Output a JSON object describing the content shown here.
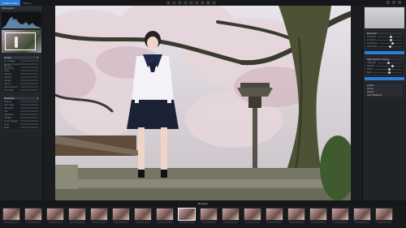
{
  "app": {
    "title": "Capture One",
    "tabs": [
      "Capture One",
      "Library"
    ]
  },
  "toolbar": {
    "icons": [
      "cursor-icon",
      "crop-icon",
      "straighten-icon",
      "keystone-icon",
      "spot-icon",
      "brush-icon",
      "eraser-icon",
      "gradient-icon",
      "picker-icon"
    ]
  },
  "left_panel": {
    "section_title": "Histogram",
    "library_title": "Library",
    "rows": [
      "All Images",
      "Recent Imports",
      "Recent Captures",
      "Trash",
      "Session",
      "Selects",
      "Output",
      "Album",
      "Smart Album",
      "Favorites"
    ],
    "meta_title": "Metadata",
    "meta_rows": [
      "Rating",
      "Color Tag",
      "Filename",
      "ISO",
      "Aperture",
      "Shutter",
      "Focal Length",
      "Lens",
      "Date"
    ]
  },
  "right_panel": {
    "sections": [
      "Exposure",
      "High Dynamic Range",
      "Levels",
      "Curve",
      "Clarity",
      "Color Balance"
    ],
    "sliders": [
      {
        "label": "Exposure",
        "value": 0.5
      },
      {
        "label": "Contrast",
        "value": 0.5
      },
      {
        "label": "Brightness",
        "value": 0.55
      },
      {
        "label": "Saturation",
        "value": 0.45
      },
      {
        "label": "Highlight",
        "value": 0.4
      },
      {
        "label": "Shadow",
        "value": 0.6
      },
      {
        "label": "White",
        "value": 0.5
      },
      {
        "label": "Black",
        "value": 0.5
      }
    ]
  },
  "viewer": {
    "label": "Browser"
  },
  "filmstrip": {
    "count": 18,
    "selected_index": 8
  }
}
